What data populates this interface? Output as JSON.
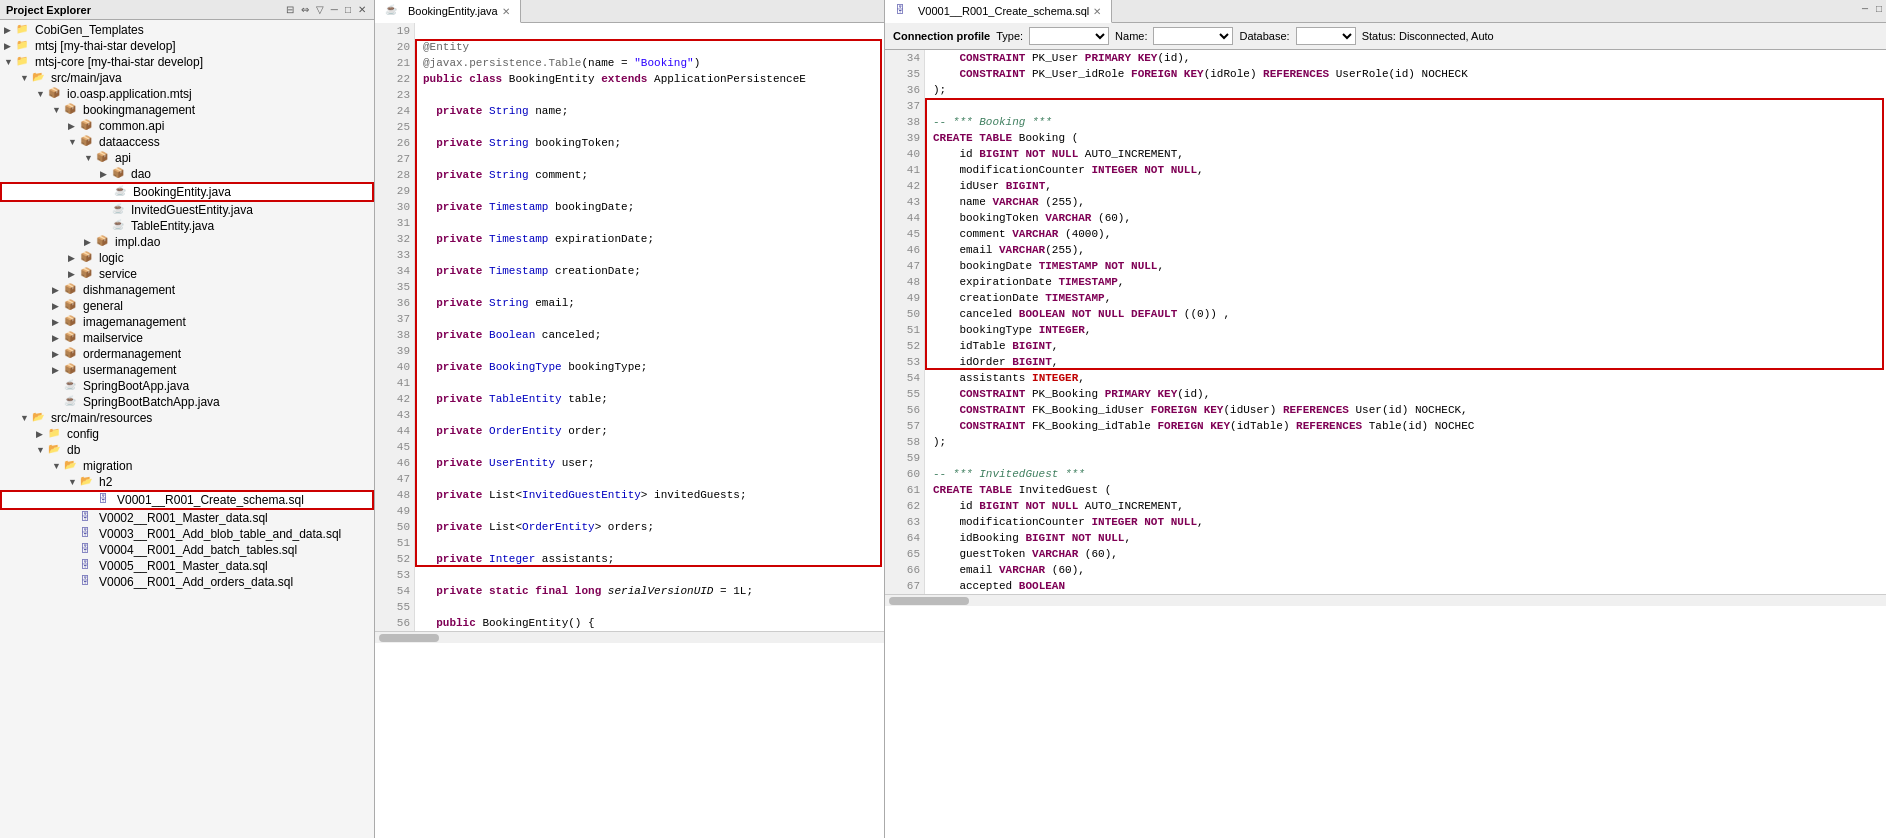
{
  "projectExplorer": {
    "title": "Project Explorer",
    "tree": [
      {
        "id": "cobiGen",
        "label": "CobiGen_Templates",
        "level": 0,
        "type": "project",
        "expanded": true
      },
      {
        "id": "mtsj",
        "label": "mtsj [my-thai-star develop]",
        "level": 0,
        "type": "project",
        "expanded": true
      },
      {
        "id": "mtsj-core",
        "label": "mtsj-core [my-thai-star develop]",
        "level": 0,
        "type": "project",
        "expanded": true
      },
      {
        "id": "src-main-java",
        "label": "src/main/java",
        "level": 1,
        "type": "folder",
        "expanded": true
      },
      {
        "id": "io-oasp",
        "label": "io.oasp.application.mtsj",
        "level": 2,
        "type": "package",
        "expanded": true
      },
      {
        "id": "bookingmgmt",
        "label": "bookingmanagement",
        "level": 3,
        "type": "package",
        "expanded": true
      },
      {
        "id": "common",
        "label": "common.api",
        "level": 4,
        "type": "package",
        "expanded": false
      },
      {
        "id": "dataaccess",
        "label": "dataaccess",
        "level": 4,
        "type": "package",
        "expanded": true
      },
      {
        "id": "api",
        "label": "api",
        "level": 5,
        "type": "package",
        "expanded": true
      },
      {
        "id": "dao",
        "label": "dao",
        "level": 6,
        "type": "package",
        "expanded": false
      },
      {
        "id": "BookingEntity",
        "label": "BookingEntity.java",
        "level": 6,
        "type": "java",
        "highlighted": true
      },
      {
        "id": "InvitedGuestEntity",
        "label": "InvitedGuestEntity.java",
        "level": 6,
        "type": "java"
      },
      {
        "id": "TableEntity",
        "label": "TableEntity.java",
        "level": 6,
        "type": "java"
      },
      {
        "id": "impl-dao",
        "label": "impl.dao",
        "level": 5,
        "type": "package",
        "expanded": false
      },
      {
        "id": "logic",
        "label": "logic",
        "level": 4,
        "type": "package",
        "expanded": false
      },
      {
        "id": "service",
        "label": "service",
        "level": 4,
        "type": "package",
        "expanded": false
      },
      {
        "id": "dishmgmt",
        "label": "dishmanagement",
        "level": 3,
        "type": "package",
        "expanded": false
      },
      {
        "id": "general",
        "label": "general",
        "level": 3,
        "type": "package",
        "expanded": false
      },
      {
        "id": "imagemgmt",
        "label": "imagemanagement",
        "level": 3,
        "type": "package",
        "expanded": false
      },
      {
        "id": "mailservice",
        "label": "mailservice",
        "level": 3,
        "type": "package",
        "expanded": false
      },
      {
        "id": "ordermgmt",
        "label": "ordermanagement",
        "level": 3,
        "type": "package",
        "expanded": false
      },
      {
        "id": "usermgmt",
        "label": "usermanagement",
        "level": 3,
        "type": "package",
        "expanded": false
      },
      {
        "id": "SpringBootApp",
        "label": "SpringBootApp.java",
        "level": 3,
        "type": "java"
      },
      {
        "id": "SpringBootBatchApp",
        "label": "SpringBootBatchApp.java",
        "level": 3,
        "type": "java"
      },
      {
        "id": "src-main-resources",
        "label": "src/main/resources",
        "level": 1,
        "type": "folder",
        "expanded": true
      },
      {
        "id": "config",
        "label": "config",
        "level": 2,
        "type": "folder",
        "expanded": false
      },
      {
        "id": "db",
        "label": "db",
        "level": 2,
        "type": "folder",
        "expanded": true
      },
      {
        "id": "migration",
        "label": "migration",
        "level": 3,
        "type": "folder",
        "expanded": true
      },
      {
        "id": "h2",
        "label": "h2",
        "level": 4,
        "type": "folder",
        "expanded": true
      },
      {
        "id": "V0001",
        "label": "V0001__R001_Create_schema.sql",
        "level": 5,
        "type": "sql",
        "highlighted": true
      },
      {
        "id": "V0002",
        "label": "V0002__R001_Master_data.sql",
        "level": 4,
        "type": "sql"
      },
      {
        "id": "V0003",
        "label": "V0003__R001_Add_blob_table_and_data.sql",
        "level": 4,
        "type": "sql"
      },
      {
        "id": "V0004",
        "label": "V0004__R001_Add_batch_tables.sql",
        "level": 4,
        "type": "sql"
      },
      {
        "id": "V0005",
        "label": "V0005__R001_Master_data.sql",
        "level": 4,
        "type": "sql"
      },
      {
        "id": "V0006",
        "label": "V0006__R001_Add_orders_data.sql",
        "level": 4,
        "type": "sql"
      }
    ]
  },
  "javaEditor": {
    "tab": "BookingEntity.java",
    "lines": [
      {
        "num": 19,
        "content": ""
      },
      {
        "num": 20,
        "content": "@Entity"
      },
      {
        "num": 21,
        "content": "@javax.persistence.Table(name = \"Booking\")"
      },
      {
        "num": 22,
        "content": "public class BookingEntity extends ApplicationPersistenceE"
      },
      {
        "num": 23,
        "content": ""
      },
      {
        "num": 24,
        "content": "  private String name;"
      },
      {
        "num": 25,
        "content": ""
      },
      {
        "num": 26,
        "content": "  private String bookingToken;"
      },
      {
        "num": 27,
        "content": ""
      },
      {
        "num": 28,
        "content": "  private String comment;"
      },
      {
        "num": 29,
        "content": ""
      },
      {
        "num": 30,
        "content": "  private Timestamp bookingDate;"
      },
      {
        "num": 31,
        "content": ""
      },
      {
        "num": 32,
        "content": "  private Timestamp expirationDate;"
      },
      {
        "num": 33,
        "content": ""
      },
      {
        "num": 34,
        "content": "  private Timestamp creationDate;"
      },
      {
        "num": 35,
        "content": ""
      },
      {
        "num": 36,
        "content": "  private String email;"
      },
      {
        "num": 37,
        "content": ""
      },
      {
        "num": 38,
        "content": "  private Boolean canceled;"
      },
      {
        "num": 39,
        "content": ""
      },
      {
        "num": 40,
        "content": "  private BookingType bookingType;"
      },
      {
        "num": 41,
        "content": ""
      },
      {
        "num": 42,
        "content": "  private TableEntity table;"
      },
      {
        "num": 43,
        "content": ""
      },
      {
        "num": 44,
        "content": "  private OrderEntity order;"
      },
      {
        "num": 45,
        "content": ""
      },
      {
        "num": 46,
        "content": "  private UserEntity user;"
      },
      {
        "num": 47,
        "content": ""
      },
      {
        "num": 48,
        "content": "  private List<InvitedGuestEntity> invitedGuests;"
      },
      {
        "num": 49,
        "content": ""
      },
      {
        "num": 50,
        "content": "  private List<OrderEntity> orders;"
      },
      {
        "num": 51,
        "content": ""
      },
      {
        "num": 52,
        "content": "  private Integer assistants;"
      },
      {
        "num": 53,
        "content": ""
      },
      {
        "num": 54,
        "content": "  private static final long serialVersionUID = 1L;"
      },
      {
        "num": 55,
        "content": ""
      },
      {
        "num": 56,
        "content": "  public BookingEntity() {"
      }
    ]
  },
  "sqlEditor": {
    "tab": "V0001__R001_Create_schema.sql",
    "connectionProfile": "Connection profile",
    "typeLabel": "Type:",
    "nameLabel": "Name:",
    "databaseLabel": "Database:",
    "statusLabel": "Status: Disconnected, Auto",
    "lines": [
      {
        "num": 34,
        "content": "    CONSTRAINT PK_User PRIMARY KEY(id),"
      },
      {
        "num": 35,
        "content": "    CONSTRAINT PK_User_idRole FOREIGN KEY(idRole) REFERENCES UserRole(id) NOCHECK"
      },
      {
        "num": 36,
        "content": ");"
      },
      {
        "num": 37,
        "content": ""
      },
      {
        "num": 38,
        "content": "-- *** Booking ***"
      },
      {
        "num": 39,
        "content": "CREATE TABLE Booking ("
      },
      {
        "num": 40,
        "content": "    id BIGINT NOT NULL AUTO_INCREMENT,"
      },
      {
        "num": 41,
        "content": "    modificationCounter INTEGER NOT NULL,"
      },
      {
        "num": 42,
        "content": "    idUser BIGINT,"
      },
      {
        "num": 43,
        "content": "    name VARCHAR (255),"
      },
      {
        "num": 44,
        "content": "    bookingToken VARCHAR (60),"
      },
      {
        "num": 45,
        "content": "    comment VARCHAR (4000),"
      },
      {
        "num": 46,
        "content": "    email VARCHAR(255),"
      },
      {
        "num": 47,
        "content": "    bookingDate TIMESTAMP NOT NULL,"
      },
      {
        "num": 48,
        "content": "    expirationDate TIMESTAMP,"
      },
      {
        "num": 49,
        "content": "    creationDate TIMESTAMP,"
      },
      {
        "num": 50,
        "content": "    canceled BOOLEAN NOT NULL DEFAULT ((0)) ,"
      },
      {
        "num": 51,
        "content": "    bookingType INTEGER,"
      },
      {
        "num": 52,
        "content": "    idTable BIGINT,"
      },
      {
        "num": 53,
        "content": "    idOrder BIGINT,"
      },
      {
        "num": 54,
        "content": "    assistants INTEGER,"
      },
      {
        "num": 55,
        "content": "    CONSTRAINT PK_Booking PRIMARY KEY(id),"
      },
      {
        "num": 56,
        "content": "    CONSTRAINT FK_Booking_idUser FOREIGN KEY(idUser) REFERENCES User(id) NOCHECK,"
      },
      {
        "num": 57,
        "content": "    CONSTRAINT FK_Booking_idTable FOREIGN KEY(idTable) REFERENCES Table(id) NOCHEC"
      },
      {
        "num": 58,
        "content": ");"
      },
      {
        "num": 59,
        "content": ""
      },
      {
        "num": 60,
        "content": "-- *** InvitedGuest ***"
      },
      {
        "num": 61,
        "content": "CREATE TABLE InvitedGuest ("
      },
      {
        "num": 62,
        "content": "    id BIGINT NOT NULL AUTO_INCREMENT,"
      },
      {
        "num": 63,
        "content": "    modificationCounter INTEGER NOT NULL,"
      },
      {
        "num": 64,
        "content": "    idBooking BIGINT NOT NULL,"
      },
      {
        "num": 65,
        "content": "    guestToken VARCHAR (60),"
      },
      {
        "num": 66,
        "content": "    email VARCHAR (60),"
      },
      {
        "num": 67,
        "content": "    accepted BOOLEAN"
      }
    ]
  }
}
